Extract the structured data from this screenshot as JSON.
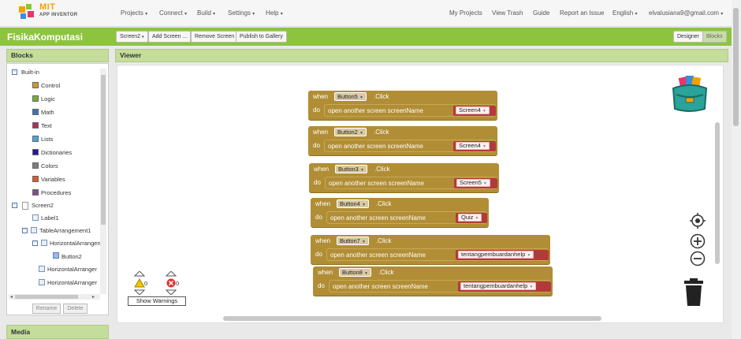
{
  "header": {
    "logo_line1": "MIT",
    "logo_line2": "APP INVENTOR",
    "menus": [
      "Projects",
      "Connect",
      "Build",
      "Settings",
      "Help"
    ],
    "links": [
      "My Projects",
      "View Trash",
      "Guide",
      "Report an Issue",
      "English",
      "elvalusiana9@gmail.com"
    ]
  },
  "toolbar": {
    "project_name": "FisikaKomputasi",
    "screen_select": "Screen2",
    "add_screen": "Add Screen ...",
    "remove_screen": "Remove Screen",
    "publish": "Publish to Gallery",
    "designer": "Designer",
    "blocks": "Blocks"
  },
  "blocks_panel": {
    "title": "Blocks",
    "builtin_label": "Built-in",
    "builtin": [
      {
        "label": "Control",
        "color": "#c89a2c"
      },
      {
        "label": "Logic",
        "color": "#77ab41"
      },
      {
        "label": "Math",
        "color": "#3f71b5"
      },
      {
        "label": "Text",
        "color": "#b32d5e"
      },
      {
        "label": "Lists",
        "color": "#49a6d4"
      },
      {
        "label": "Dictionaries",
        "color": "#2d1799"
      },
      {
        "label": "Colors",
        "color": "#7d7d7d"
      },
      {
        "label": "Variables",
        "color": "#d05f2d"
      },
      {
        "label": "Procedures",
        "color": "#7c5385"
      }
    ],
    "components": {
      "screen": "Screen2",
      "label1": "Label1",
      "table": "TableArrangement1",
      "horiz1": "HorizontalArrangen",
      "button2": "Button2",
      "horiz2": "HorizontalArranger",
      "horiz3": "HorizontalArranger"
    },
    "rename": "Rename",
    "delete": "Delete",
    "media": "Media"
  },
  "viewer": {
    "title": "Viewer",
    "when": "when",
    "do": "do",
    "click": ".Click",
    "action": "open another screen  screenName",
    "events": [
      {
        "button": "Button5",
        "screen": "Screen4"
      },
      {
        "button": "Button2",
        "screen": "Screen4"
      },
      {
        "button": "Button3",
        "screen": "Screen5"
      },
      {
        "button": "Button4",
        "screen": "Quiz"
      },
      {
        "button": "Button7",
        "screen": "tentangpembuardanhelp"
      },
      {
        "button": "Button8",
        "screen": "tentangpembuardanhelp"
      }
    ],
    "warnings_count": "0",
    "errors_count": "0",
    "show_warnings": "Show Warnings"
  }
}
